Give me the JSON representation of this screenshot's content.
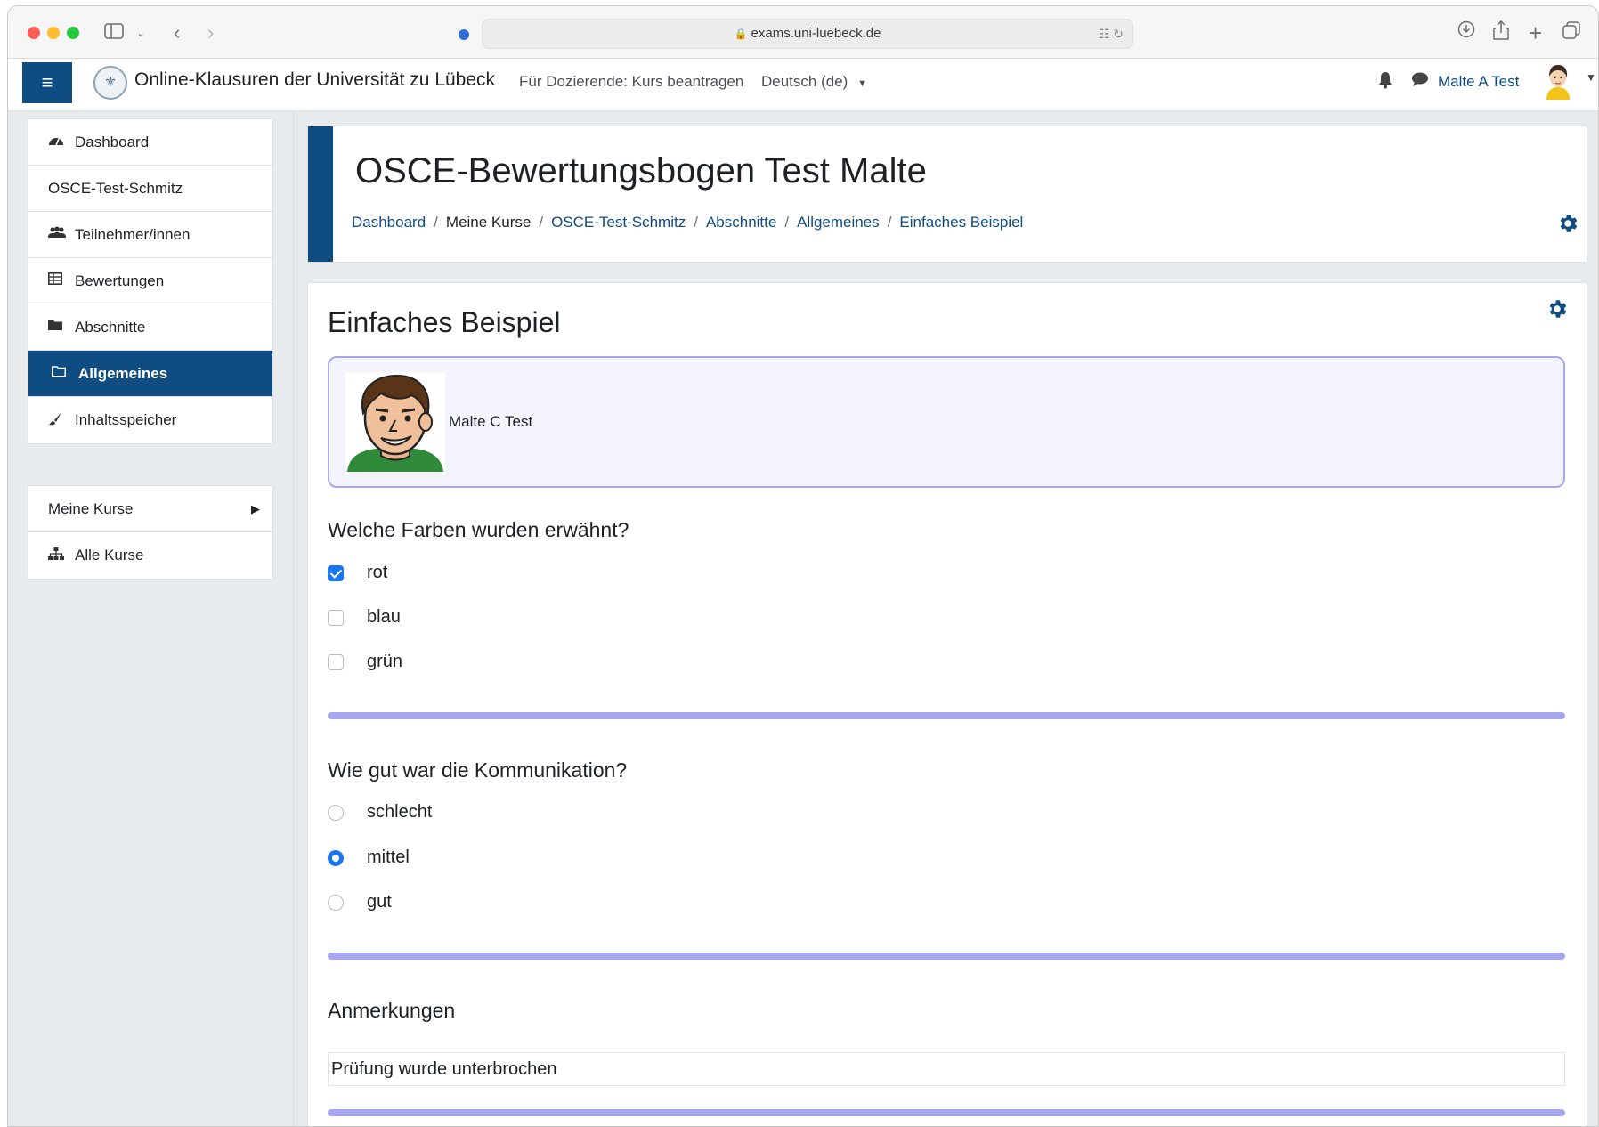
{
  "browser": {
    "url": "exams.uni-luebeck.de"
  },
  "navbar": {
    "site_name": "Online-Klausuren der Universität zu Lübeck",
    "teacher_link": "Für Dozierende: Kurs beantragen",
    "language": "Deutsch (de)",
    "user_name": "Malte A Test"
  },
  "drawer": {
    "items": [
      {
        "label": "Dashboard",
        "icon": "dashboard-icon"
      },
      {
        "label": "OSCE-Test-Schmitz",
        "icon": ""
      },
      {
        "label": "Teilnehmer/innen",
        "icon": "users-icon"
      },
      {
        "label": "Bewertungen",
        "icon": "table-icon"
      },
      {
        "label": "Abschnitte",
        "icon": "folder-icon"
      },
      {
        "label": "Allgemeines",
        "icon": "folder-open-icon",
        "active": true
      },
      {
        "label": "Inhaltsspeicher",
        "icon": "brush-icon"
      }
    ],
    "secondary": [
      {
        "label": "Meine Kurse",
        "icon": ""
      },
      {
        "label": "Alle Kurse",
        "icon": "sitemap-icon"
      }
    ]
  },
  "header": {
    "title": "OSCE-Bewertungsbogen Test Malte",
    "breadcrumb": [
      {
        "label": "Dashboard",
        "link": true
      },
      {
        "label": "Meine Kurse",
        "link": false
      },
      {
        "label": "OSCE-Test-Schmitz",
        "link": true
      },
      {
        "label": "Abschnitte",
        "link": true
      },
      {
        "label": "Allgemeines",
        "link": true
      },
      {
        "label": "Einfaches Beispiel",
        "link": true
      }
    ]
  },
  "content": {
    "title": "Einfaches Beispiel",
    "candidate_name": "Malte C Test",
    "q1": {
      "question": "Welche Farben wurden erwähnt?",
      "options": [
        {
          "label": "rot",
          "checked": true
        },
        {
          "label": "blau",
          "checked": false
        },
        {
          "label": "grün",
          "checked": false
        }
      ]
    },
    "q2": {
      "question": "Wie gut war die Kommunikation?",
      "options": [
        {
          "label": "schlecht",
          "checked": false
        },
        {
          "label": "mittel",
          "checked": true
        },
        {
          "label": "gut",
          "checked": false
        }
      ]
    },
    "notes": {
      "label": "Anmerkungen",
      "value": "Prüfung wurde unterbrochen"
    }
  },
  "colors": {
    "brand": "#0f4c81",
    "accent": "#1877f2",
    "divider": "#a7a7f0"
  }
}
